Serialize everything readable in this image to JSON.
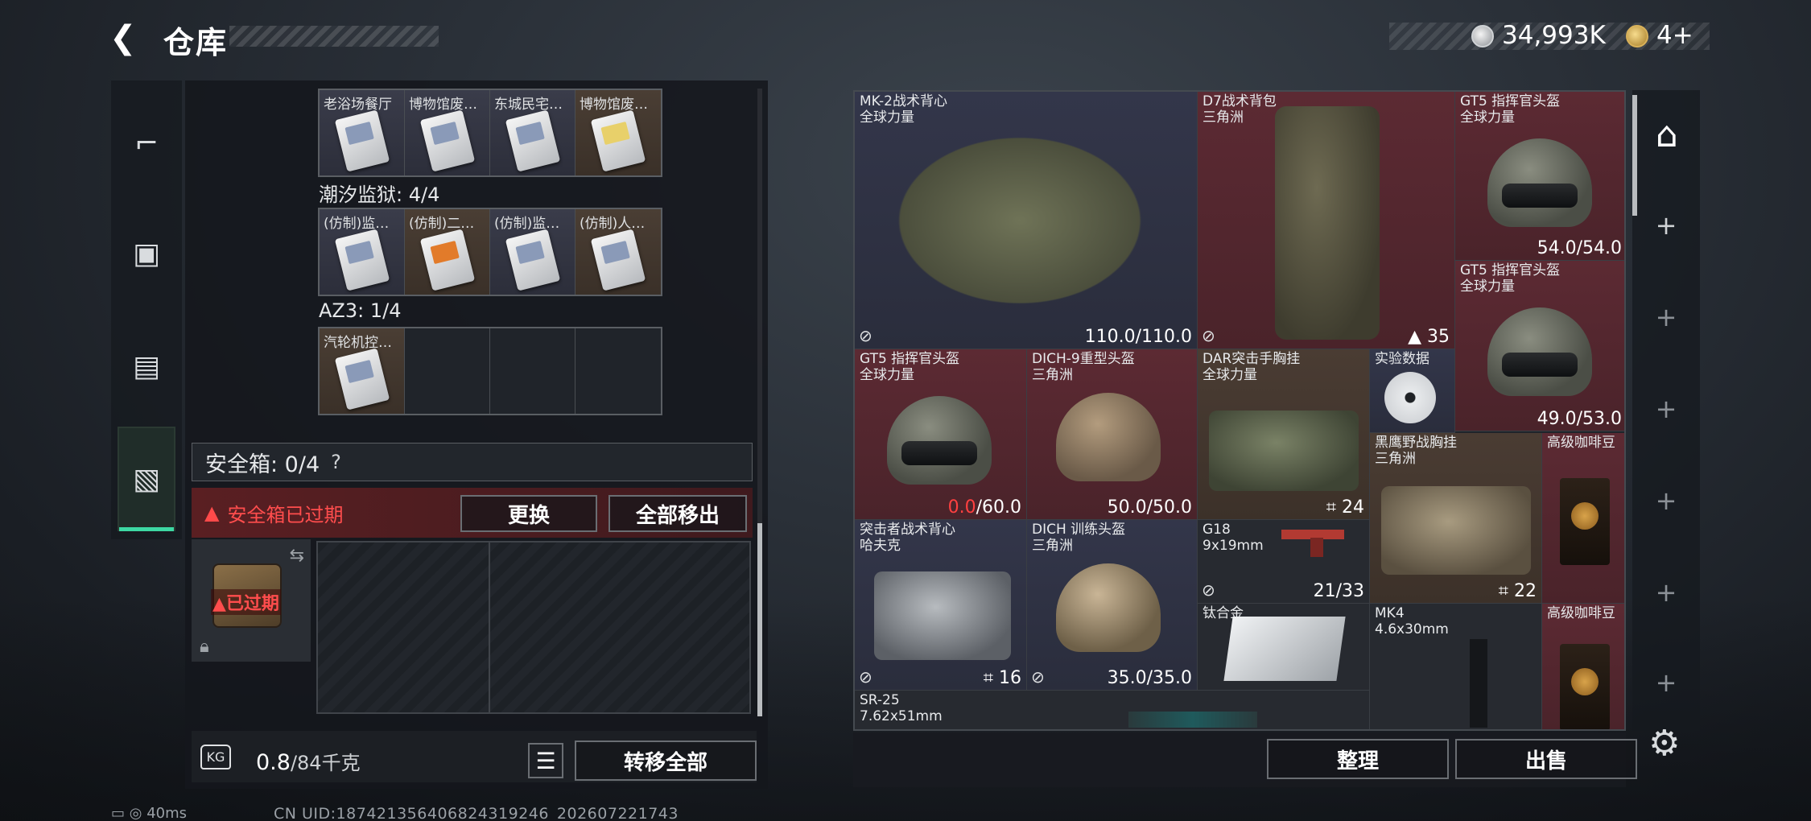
{
  "header": {
    "title": "仓库"
  },
  "currency": {
    "silver": "34,993K",
    "gold": "4+"
  },
  "left_panel": {
    "row1": [
      "老浴场餐厅",
      "博物馆废…",
      "东城民宅…",
      "博物馆废…"
    ],
    "group2_label": "潮汐监狱: 4/4",
    "row2": [
      "(仿制)监…",
      "(仿制)二…",
      "(仿制)监…",
      "(仿制)人…"
    ],
    "group3_label": "AZ3: 1/4",
    "row3": [
      "汽轮机控…"
    ],
    "safe_label": "安全箱: 0/4",
    "safe_help": "?",
    "safe_warning": "安全箱已过期",
    "btn_replace": "更换",
    "btn_move_all": "全部移出",
    "safebox_expired": "已过期",
    "weight_value": "0.8",
    "weight_max": "/84千克",
    "btn_transfer_all": "转移全部",
    "kg_label": "KG"
  },
  "stash": {
    "items": [
      {
        "name": "MK-2战术背心",
        "sub": "全球力量",
        "value": "110.0/110.0"
      },
      {
        "name": "D7战术背包",
        "sub": "三角洲",
        "value": "35"
      },
      {
        "name": "GT5 指挥官头盔",
        "sub": "全球力量",
        "value": "54.0/54.0"
      },
      {
        "name": "GT5 指挥官头盔",
        "sub": "全球力量",
        "value": "49.0/53.0"
      },
      {
        "name": "GT5 指挥官头盔",
        "sub": "全球力量",
        "value_red": "0.0",
        "value": "/60.0"
      },
      {
        "name": "DICH-9重型头盔",
        "sub": "三角洲",
        "value": "50.0/50.0"
      },
      {
        "name": "DAR突击手胸挂",
        "sub": "全球力量",
        "value": "24"
      },
      {
        "name": "实验数据",
        "sub": "",
        "value": ""
      },
      {
        "name": "黑鹰野战胸挂",
        "sub": "三角洲",
        "value": "22"
      },
      {
        "name": "高级咖啡豆",
        "sub": "",
        "value": ""
      },
      {
        "name": "突击者战术背心",
        "sub": "哈夫克",
        "value": "16"
      },
      {
        "name": "DICH 训练头盔",
        "sub": "三角洲",
        "value": "35.0/35.0"
      },
      {
        "name": "G18",
        "sub": "9x19mm",
        "value": "21/33"
      },
      {
        "name": "钛合金",
        "sub": "",
        "value": ""
      },
      {
        "name": "MK4",
        "sub": "4.6x30mm",
        "value": ""
      },
      {
        "name": "高级咖啡豆",
        "sub": "",
        "value": ""
      },
      {
        "name": "SR-25",
        "sub": "7.62x51mm",
        "value": ""
      }
    ],
    "btn_organize": "整理",
    "btn_sell": "出售"
  },
  "status": {
    "ping": "40ms",
    "uid": "CN UID:18742135640682431924​6_202607221743"
  }
}
